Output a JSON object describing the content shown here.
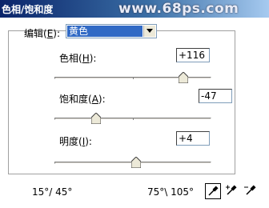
{
  "window": {
    "title": "色相/饱和度"
  },
  "watermark": "www.68ps.com",
  "edit": {
    "label": "编辑",
    "shortcut": "E",
    "suffix": "):",
    "value": "黄色"
  },
  "hue": {
    "label": "色相",
    "shortcut": "H",
    "value": "+116",
    "numeric": 116,
    "min": -180,
    "max": 180
  },
  "saturation": {
    "label": "饱和度",
    "shortcut": "A",
    "value": "-47",
    "numeric": -47,
    "min": -100,
    "max": 100
  },
  "lightness": {
    "label": "明度",
    "shortcut": "I",
    "value": "+4",
    "numeric": 4,
    "min": -100,
    "max": 100
  },
  "range": {
    "left": "15°/ 45°",
    "right": "75°\\ 105°"
  },
  "eyedroppers": [
    {
      "name": "eyedropper-icon",
      "active": true
    },
    {
      "name": "eyedropper-plus-icon",
      "active": false
    },
    {
      "name": "eyedropper-minus-icon",
      "active": false
    }
  ],
  "colors": {
    "titlebar_start": "#0a246a",
    "titlebar_end": "#a6caf0",
    "selection": "#316ac5"
  }
}
